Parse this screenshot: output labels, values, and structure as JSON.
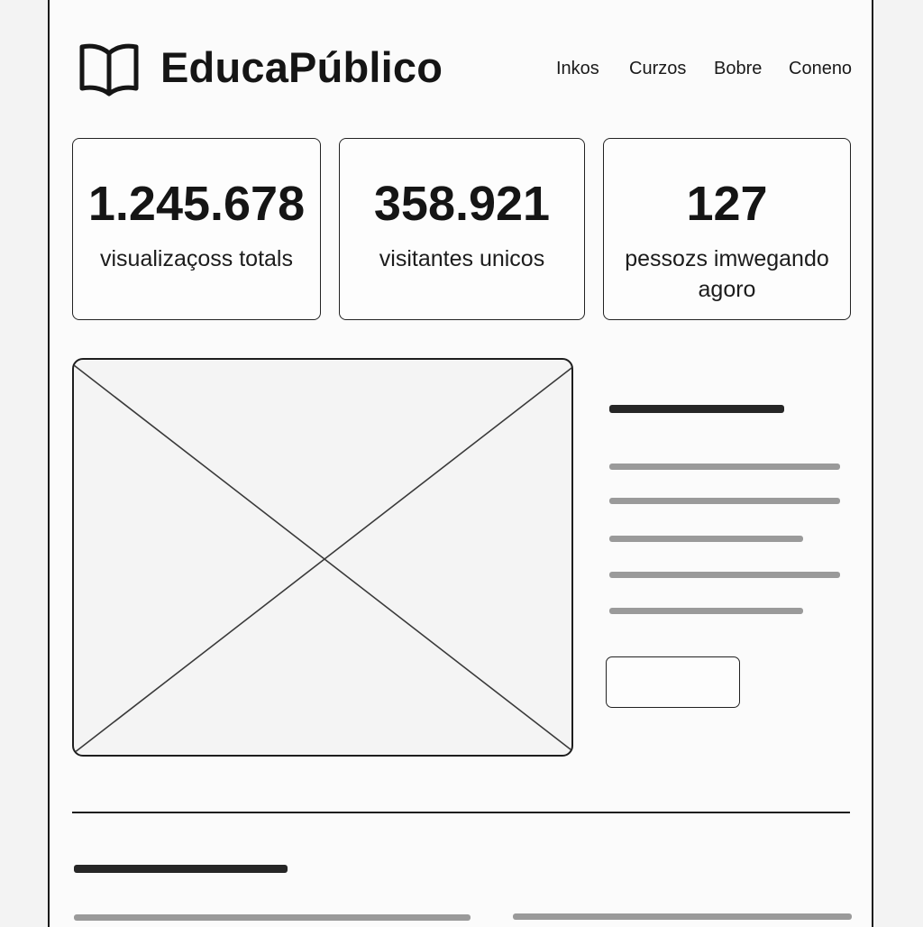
{
  "header": {
    "brand": "EducaPúblico",
    "logo_icon": "open-book-icon",
    "nav": [
      {
        "label": "Inkos"
      },
      {
        "label": "Curzos"
      },
      {
        "label": "Bobre"
      },
      {
        "label": "Coneno"
      }
    ]
  },
  "stats": [
    {
      "value": "1.245.678",
      "label": "visualizaçoss totals"
    },
    {
      "value": "358.921",
      "label": "visitantes unicos"
    },
    {
      "value": "127",
      "label": "pessozs imwegando agoro"
    }
  ],
  "media": {
    "placeholder_icon": "image-placeholder-icon"
  },
  "colors": {
    "ink": "#151515",
    "placeholder_line": "#9a9a9a",
    "page_bg": "#fbfbfb"
  }
}
